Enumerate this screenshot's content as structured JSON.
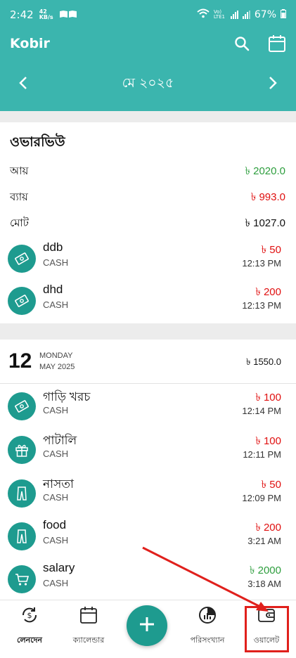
{
  "status": {
    "time": "2:42",
    "kbs_value": "42",
    "kbs_unit": "KB/s",
    "net_label": "Vo) LTE1",
    "battery": "67%"
  },
  "app": {
    "title": "Kobir"
  },
  "month_nav": {
    "label": "মে ২০২৫"
  },
  "overview": {
    "title": "ওভারভিউ",
    "rows": [
      {
        "label": "আয়",
        "value": "৳ 2020.0",
        "color": "#2e9e3e"
      },
      {
        "label": "ব্যায়",
        "value": "৳ 993.0",
        "color": "#e01010"
      },
      {
        "label": "মোট",
        "value": "৳ 1027.0",
        "color": "#111111"
      }
    ],
    "transactions": [
      {
        "name": "ddb",
        "account": "CASH",
        "amount": "৳ 50",
        "time": "12:13 PM",
        "icon": "money-icon",
        "color": "#e01010"
      },
      {
        "name": "dhd",
        "account": "CASH",
        "amount": "৳ 200",
        "time": "12:13 PM",
        "icon": "money-icon",
        "color": "#e01010"
      }
    ]
  },
  "day": {
    "number": "12",
    "weekday": "MONDAY",
    "month_year": "MAY 2025",
    "total": "৳ 1550.0",
    "transactions": [
      {
        "name": "গাড়ি খরচ",
        "account": "CASH",
        "amount": "৳ 100",
        "time": "12:14 PM",
        "icon": "money-icon",
        "color": "#e01010"
      },
      {
        "name": "পাটালি",
        "account": "CASH",
        "amount": "৳ 100",
        "time": "12:11 PM",
        "icon": "gift-icon",
        "color": "#e01010"
      },
      {
        "name": "নাসতা",
        "account": "CASH",
        "amount": "৳ 50",
        "time": "12:09 PM",
        "icon": "pants-icon",
        "color": "#e01010"
      },
      {
        "name": "food",
        "account": "CASH",
        "amount": "৳ 200",
        "time": "3:21 AM",
        "icon": "pants-icon",
        "color": "#e01010"
      },
      {
        "name": "salary",
        "account": "CASH",
        "amount": "৳ 2000",
        "time": "3:18 AM",
        "icon": "cart-icon",
        "color": "#2e9e3e"
      }
    ]
  },
  "bottom_nav": {
    "items": [
      {
        "label": "লেনদেন",
        "icon": "transactions-icon",
        "active": true
      },
      {
        "label": "ক্যালেন্ডার",
        "icon": "calendar-icon",
        "active": false
      },
      {
        "label": "পরিসংখ্যান",
        "icon": "stats-icon",
        "active": false
      },
      {
        "label": "ওয়ালেট",
        "icon": "wallet-icon",
        "active": false
      }
    ]
  },
  "colors": {
    "primary": "#3bb5ae",
    "icon_bg": "#1e9b8f",
    "income": "#2e9e3e",
    "expense": "#e01010",
    "annotation": "#e0201c"
  }
}
